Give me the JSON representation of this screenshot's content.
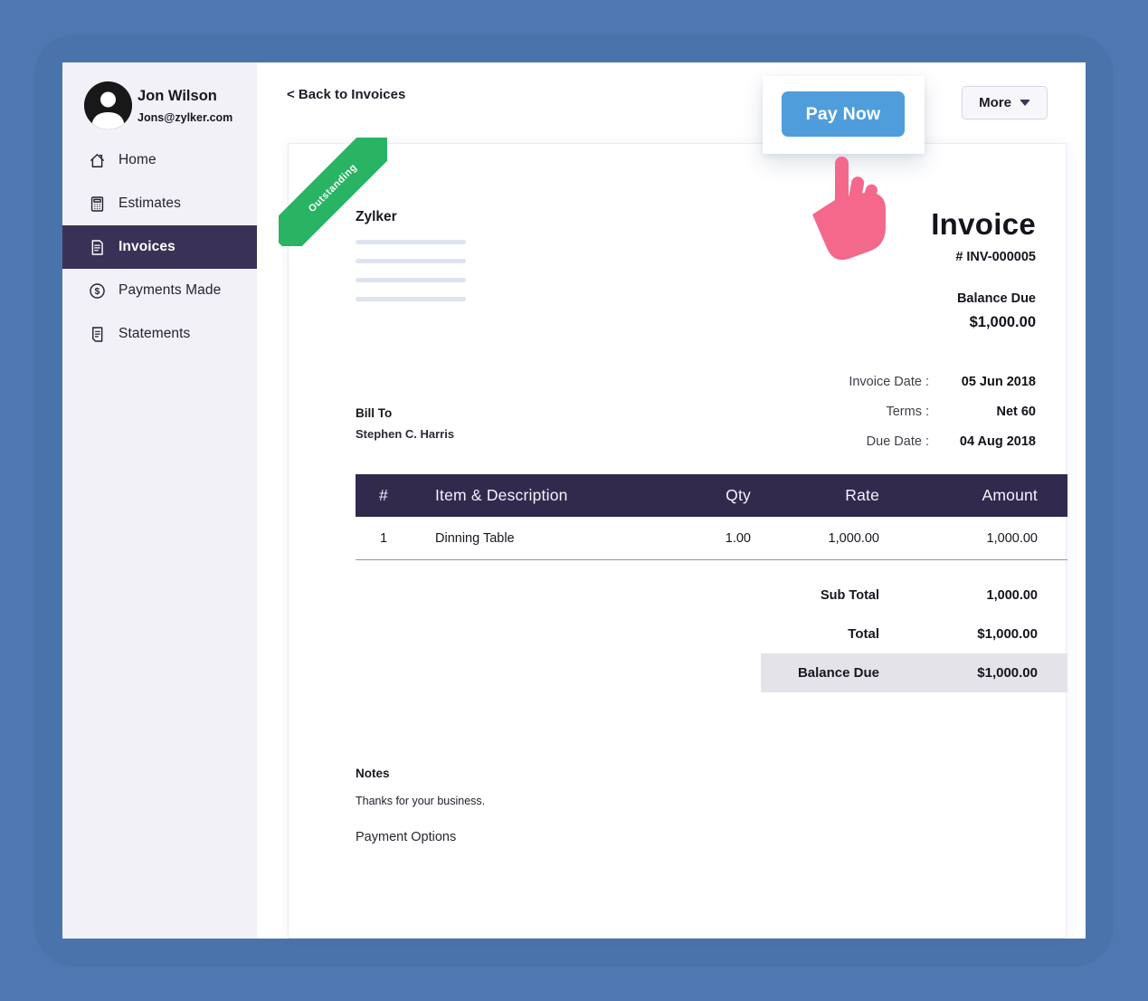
{
  "colors": {
    "background": "#4f78b2",
    "frame": "#4a73ab",
    "sidebar_bg": "#f2f1f7",
    "sidebar_selected": "#3a3157",
    "table_header": "#322a4d",
    "pay_now_blue": "#4f9edb",
    "ribbon_green": "#28b463",
    "ribbon_fold": "#17834b",
    "hand_pink": "#f4688c",
    "balance_row_bg": "#e4e3e9",
    "placeholder_line": "#dfe3f0"
  },
  "sidebar": {
    "user": {
      "name": "Jon Wilson",
      "email": "Jons@zylker.com"
    },
    "items": [
      {
        "label": "Home",
        "icon": "home-icon",
        "selected": false
      },
      {
        "label": "Estimates",
        "icon": "calculator-icon",
        "selected": false
      },
      {
        "label": "Invoices",
        "icon": "invoice-document-icon",
        "selected": true
      },
      {
        "label": "Payments Made",
        "icon": "dollar-circle-icon",
        "selected": false
      },
      {
        "label": "Statements",
        "icon": "statement-document-icon",
        "selected": false
      }
    ]
  },
  "toolbar": {
    "back_link": "< Back to Invoices",
    "pay_now_label": "Pay Now",
    "more_label": "More"
  },
  "invoice": {
    "ribbon": "Outstanding",
    "company": "Zylker",
    "title": "Invoice",
    "number": "# INV-000005",
    "balance_due_label": "Balance Due",
    "balance_due_value": "$1,000.00",
    "meta": [
      {
        "label": "Invoice Date :",
        "value": "05 Jun 2018"
      },
      {
        "label": "Terms :",
        "value": "Net 60"
      },
      {
        "label": "Due Date :",
        "value": "04 Aug 2018"
      }
    ],
    "bill_to_label": "Bill To",
    "bill_to_name": "Stephen C. Harris",
    "table": {
      "headers": [
        "#",
        "Item & Description",
        "Qty",
        "Rate",
        "Amount"
      ],
      "rows": [
        [
          "1",
          "Dinning Table",
          "1.00",
          "1,000.00",
          "1,000.00"
        ]
      ]
    },
    "totals": [
      {
        "label": "Sub Total",
        "value": "1,000.00",
        "highlight": false
      },
      {
        "label": "Total",
        "value": "$1,000.00",
        "highlight": false
      },
      {
        "label": "Balance Due",
        "value": "$1,000.00",
        "highlight": true
      }
    ],
    "notes_label": "Notes",
    "notes_text": "Thanks for your business.",
    "payment_options_label": "Payment Options"
  }
}
